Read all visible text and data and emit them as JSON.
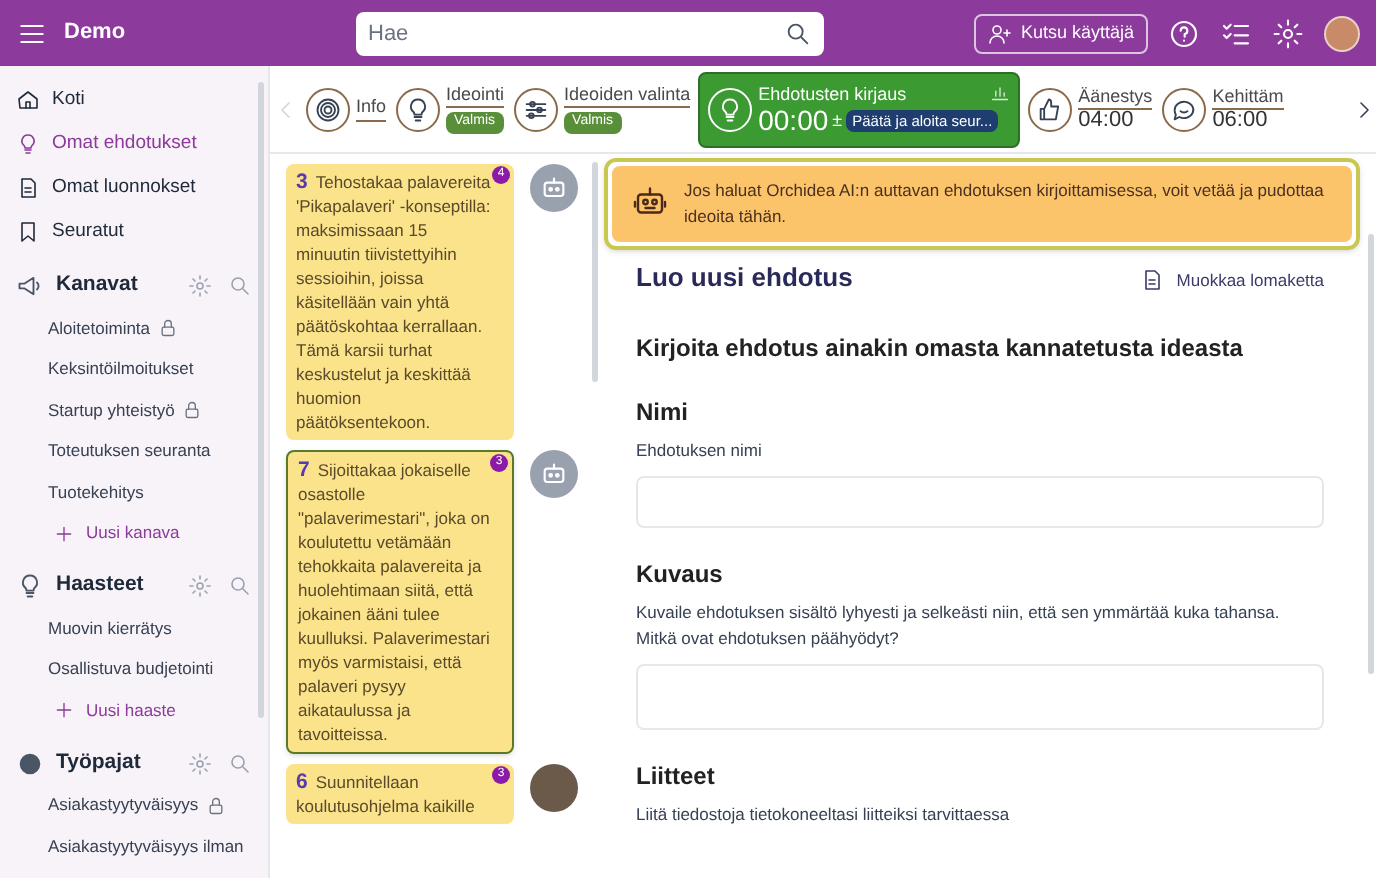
{
  "app": {
    "title": "Demo",
    "search": {
      "placeholder": "Hae"
    },
    "invite": "Kutsu käyttäjä"
  },
  "sidebar": {
    "nav": [
      {
        "label": "Koti",
        "selected": false
      },
      {
        "label": "Omat ehdotukset",
        "selected": true
      },
      {
        "label": "Omat luonnokset",
        "selected": false
      },
      {
        "label": "Seuratut",
        "selected": false
      }
    ],
    "groups": [
      {
        "title": "Kanavat",
        "items": [
          {
            "label": "Aloitetoiminta",
            "locked": true
          },
          {
            "label": "Keksintöilmoitukset",
            "locked": false
          },
          {
            "label": "Startup yhteistyö",
            "locked": true
          },
          {
            "label": "Toteutuksen seuranta",
            "locked": false
          },
          {
            "label": "Tuotekehitys",
            "locked": false
          }
        ],
        "add": "Uusi kanava"
      },
      {
        "title": "Haasteet",
        "items": [
          {
            "label": "Muovin kierrätys",
            "locked": false
          },
          {
            "label": "Osallistuva budjetointi",
            "locked": false
          }
        ],
        "add": "Uusi haaste"
      },
      {
        "title": "Työpajat",
        "items": [
          {
            "label": "Asiakastyytyväisyys",
            "locked": true
          },
          {
            "label": "Asiakastyytyväisyys ilman",
            "locked": false
          }
        ]
      }
    ]
  },
  "phases": [
    {
      "name": "Info",
      "selected": false
    },
    {
      "name": "Ideointi",
      "badge": "Valmis",
      "selected": false
    },
    {
      "name": "Ideoiden valinta",
      "badge": "Valmis",
      "selected": false
    },
    {
      "name": "Ehdotusten kirjaus",
      "time": "00:00",
      "adjust": "±",
      "action": "Päätä ja aloita seur...",
      "selected": true
    },
    {
      "name": "Äänestys",
      "time": "04:00",
      "selected": false
    },
    {
      "name": "Kehittäm",
      "time": "06:00",
      "selected": false
    }
  ],
  "ideas": [
    {
      "number": "3",
      "text": "Tehostakaa palavereita 'Pikapalaveri' -konseptilla: maksimissaan 15 minuutin tiivistettyihin sessioihin, joissa käsitellään vain yhtä päätöskohtaa kerrallaan. Tämä karsii turhat keskustelut ja keskittää huomion päätöksentekoon.",
      "count": "4",
      "kind": "robot",
      "selected": false
    },
    {
      "number": "7",
      "text": "Sijoittakaa jokaiselle osastolle \"palaverimestari\", joka on koulutettu vetämään tehokkaita palavereita ja huolehtimaan siitä, että jokainen ääni tulee kuulluksi. Palaverimestari myös varmistaisi, että palaveri pysyy aikataulussa ja tavoitteissa.",
      "count": "3",
      "kind": "robot",
      "selected": true
    },
    {
      "number": "6",
      "text": "Suunnitellaan koulutusohjelma kaikille",
      "count": "3",
      "kind": "photo",
      "selected": false
    }
  ],
  "ai_hint": "Jos haluat Orchidea AI:n auttavan ehdotuksen kirjoittamisessa, voit vetää ja pudottaa ideoita tähän.",
  "form": {
    "title": "Luo uusi ehdotus",
    "edit_link": "Muokkaa lomaketta",
    "subtitle": "Kirjoita ehdotus ainakin omasta kannatetusta ideasta",
    "fields": [
      {
        "label": "Nimi",
        "help": "Ehdotuksen nimi",
        "kind": "input"
      },
      {
        "label": "Kuvaus",
        "help": "Kuvaile ehdotuksen sisältö lyhyesti ja selkeästi niin, että sen ymmärtää kuka tahansa. Mitkä ovat ehdotuksen päähyödyt?",
        "kind": "textarea"
      },
      {
        "label": "Liitteet",
        "help": "Liitä tiedostoja tietokoneeltasi liitteiksi tarvittaessa",
        "kind": "file"
      }
    ]
  }
}
